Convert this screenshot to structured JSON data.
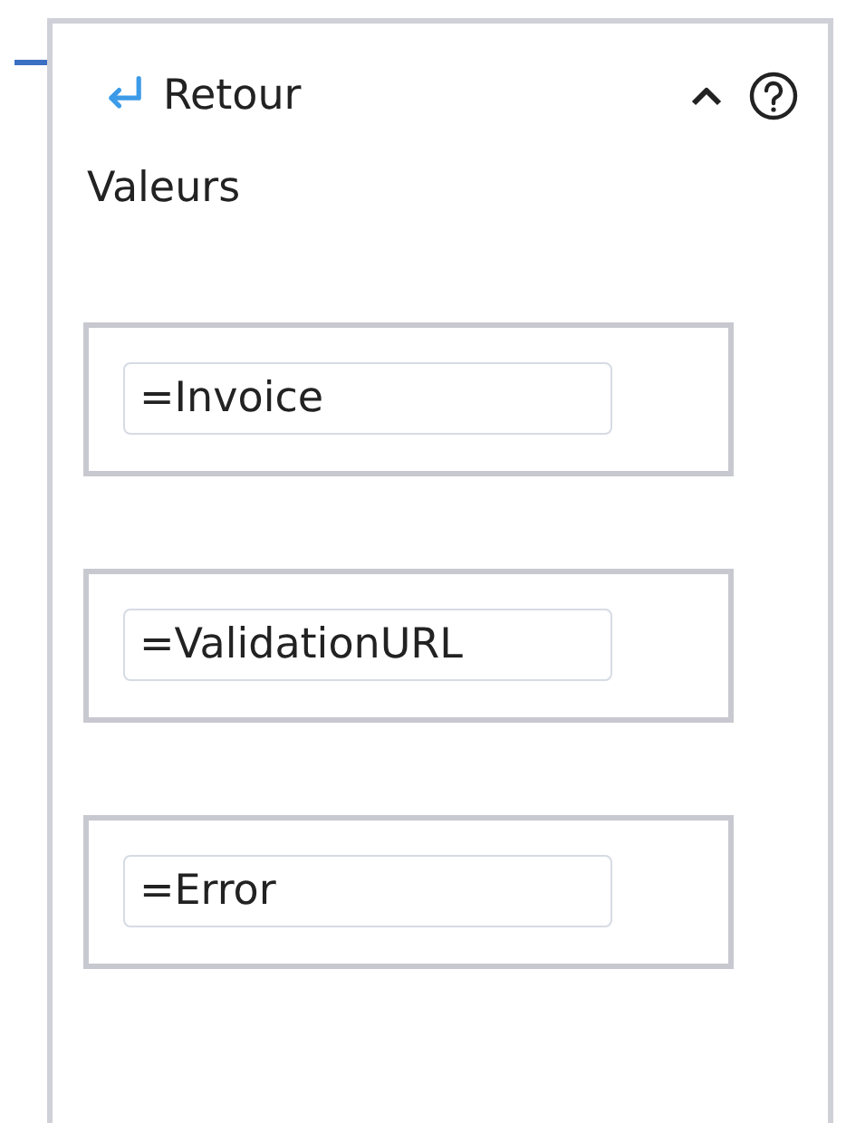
{
  "panel": {
    "back_label": "Retour",
    "expanded": true
  },
  "section_label": "Valeurs",
  "values": [
    {
      "value": "=Invoice"
    },
    {
      "value": "=ValidationURL"
    },
    {
      "value": "=Error"
    }
  ]
}
